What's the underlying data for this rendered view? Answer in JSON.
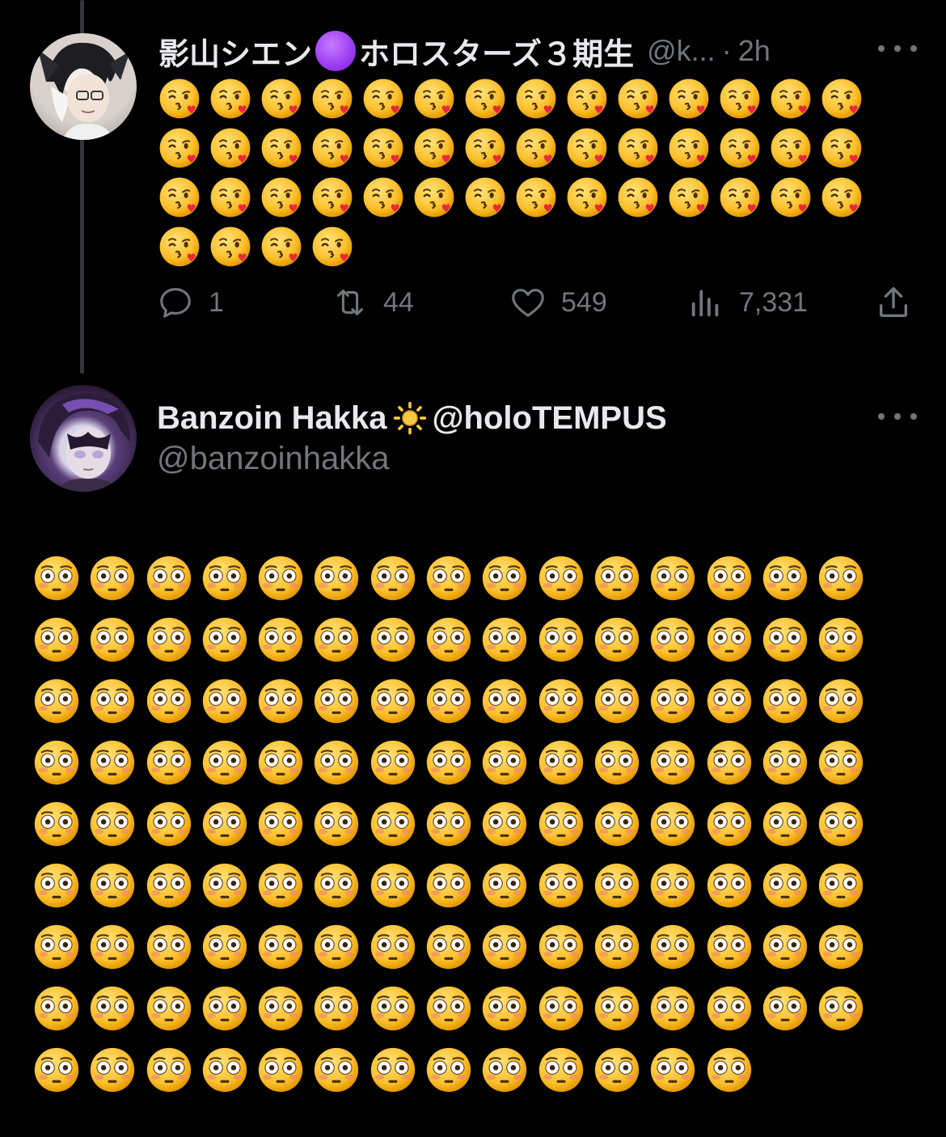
{
  "tweet1": {
    "display_name": "影山シエン",
    "name_suffix": "ホロスターズ３期生",
    "handle": "@k...",
    "separator": "·",
    "time": "2h",
    "emoji": "kissing-face-with-heart",
    "emoji_rows": [
      14,
      14,
      14,
      4
    ],
    "actions": {
      "replies": "1",
      "reposts": "44",
      "likes": "549",
      "views": "7,331"
    }
  },
  "tweet2": {
    "display_name": "Banzoin Hakka",
    "name_suffix": "@holoTEMPUS",
    "handle": "@banzoinhakka",
    "emoji": "flushed-face",
    "emoji_rows": [
      15,
      15,
      15,
      15,
      15,
      15,
      15,
      15,
      13
    ]
  },
  "colors": {
    "background": "#000000",
    "primary_text": "#e7e9ea",
    "secondary_text": "#71767b",
    "thread_line": "#333639",
    "purple_dot": "#9b3bf0"
  },
  "icons": [
    "reply-icon",
    "repost-icon",
    "like-icon",
    "views-icon",
    "share-icon",
    "more-icon",
    "sun-icon"
  ]
}
